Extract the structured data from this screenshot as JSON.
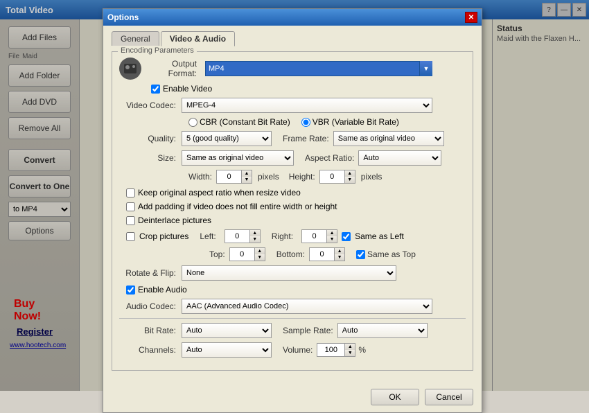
{
  "app": {
    "title": "Total Video",
    "controls": [
      "?",
      "—",
      "✕"
    ]
  },
  "sidebar": {
    "add_files_label": "Add Files",
    "add_folder_label": "Add Folder",
    "add_dvd_label": "Add DVD",
    "remove_all_label": "Remove All",
    "convert_label": "Convert",
    "convert_to_one_label": "Convert to One",
    "format_label": "to MP4",
    "options_label": "Options",
    "buy_now_label": "Buy Now!",
    "register_label": "Register",
    "website_label": "www.hootech.com",
    "file_label": "File",
    "maid_label": "Maid"
  },
  "status": {
    "label": "Status",
    "value": "Maid with the Flaxen H..."
  },
  "dialog": {
    "title": "Options",
    "tabs": [
      "General",
      "Video & Audio"
    ],
    "active_tab": "Video & Audio",
    "section_label": "Encoding Parameters",
    "output_format_label": "Output Format:",
    "output_format_value": "MP4",
    "enable_video_label": "Enable Video",
    "video_codec_label": "Video Codec:",
    "video_codec_value": "MPEG-4",
    "cbr_label": "CBR (Constant Bit Rate)",
    "vbr_label": "VBR (Variable Bit Rate)",
    "quality_label": "Quality:",
    "quality_value": "5 (good quality)",
    "framerate_label": "Frame Rate:",
    "framerate_value": "Same as original video",
    "size_label": "Size:",
    "size_value": "Same as original video",
    "aspect_label": "Aspect Ratio:",
    "aspect_value": "Auto",
    "width_label": "Width:",
    "width_value": "0",
    "pixels_label1": "pixels",
    "height_label": "Height:",
    "height_value": "0",
    "pixels_label2": "pixels",
    "keep_ratio_label": "Keep original aspect ratio when resize video",
    "add_padding_label": "Add padding if video does not fill entire width or height",
    "deinterlace_label": "Deinterlace pictures",
    "crop_label": "Crop pictures",
    "left_label": "Left:",
    "left_value": "0",
    "right_label": "Right:",
    "right_value": "0",
    "same_as_left_label": "Same as Left",
    "top_label": "Top:",
    "top_value": "0",
    "bottom_label": "Bottom:",
    "bottom_value": "0",
    "same_as_top_label": "Same as Top",
    "rotate_label": "Rotate & Flip:",
    "rotate_value": "None",
    "enable_audio_label": "Enable Audio",
    "audio_codec_label": "Audio Codec:",
    "audio_codec_value": "AAC (Advanced Audio Codec)",
    "bitrate_label": "Bit Rate:",
    "bitrate_value": "Auto",
    "samplerate_label": "Sample Rate:",
    "samplerate_value": "Auto",
    "channels_label": "Channels:",
    "channels_value": "Auto",
    "volume_label": "Volume:",
    "volume_value": "100",
    "volume_unit": "%",
    "ok_label": "OK",
    "cancel_label": "Cancel"
  }
}
